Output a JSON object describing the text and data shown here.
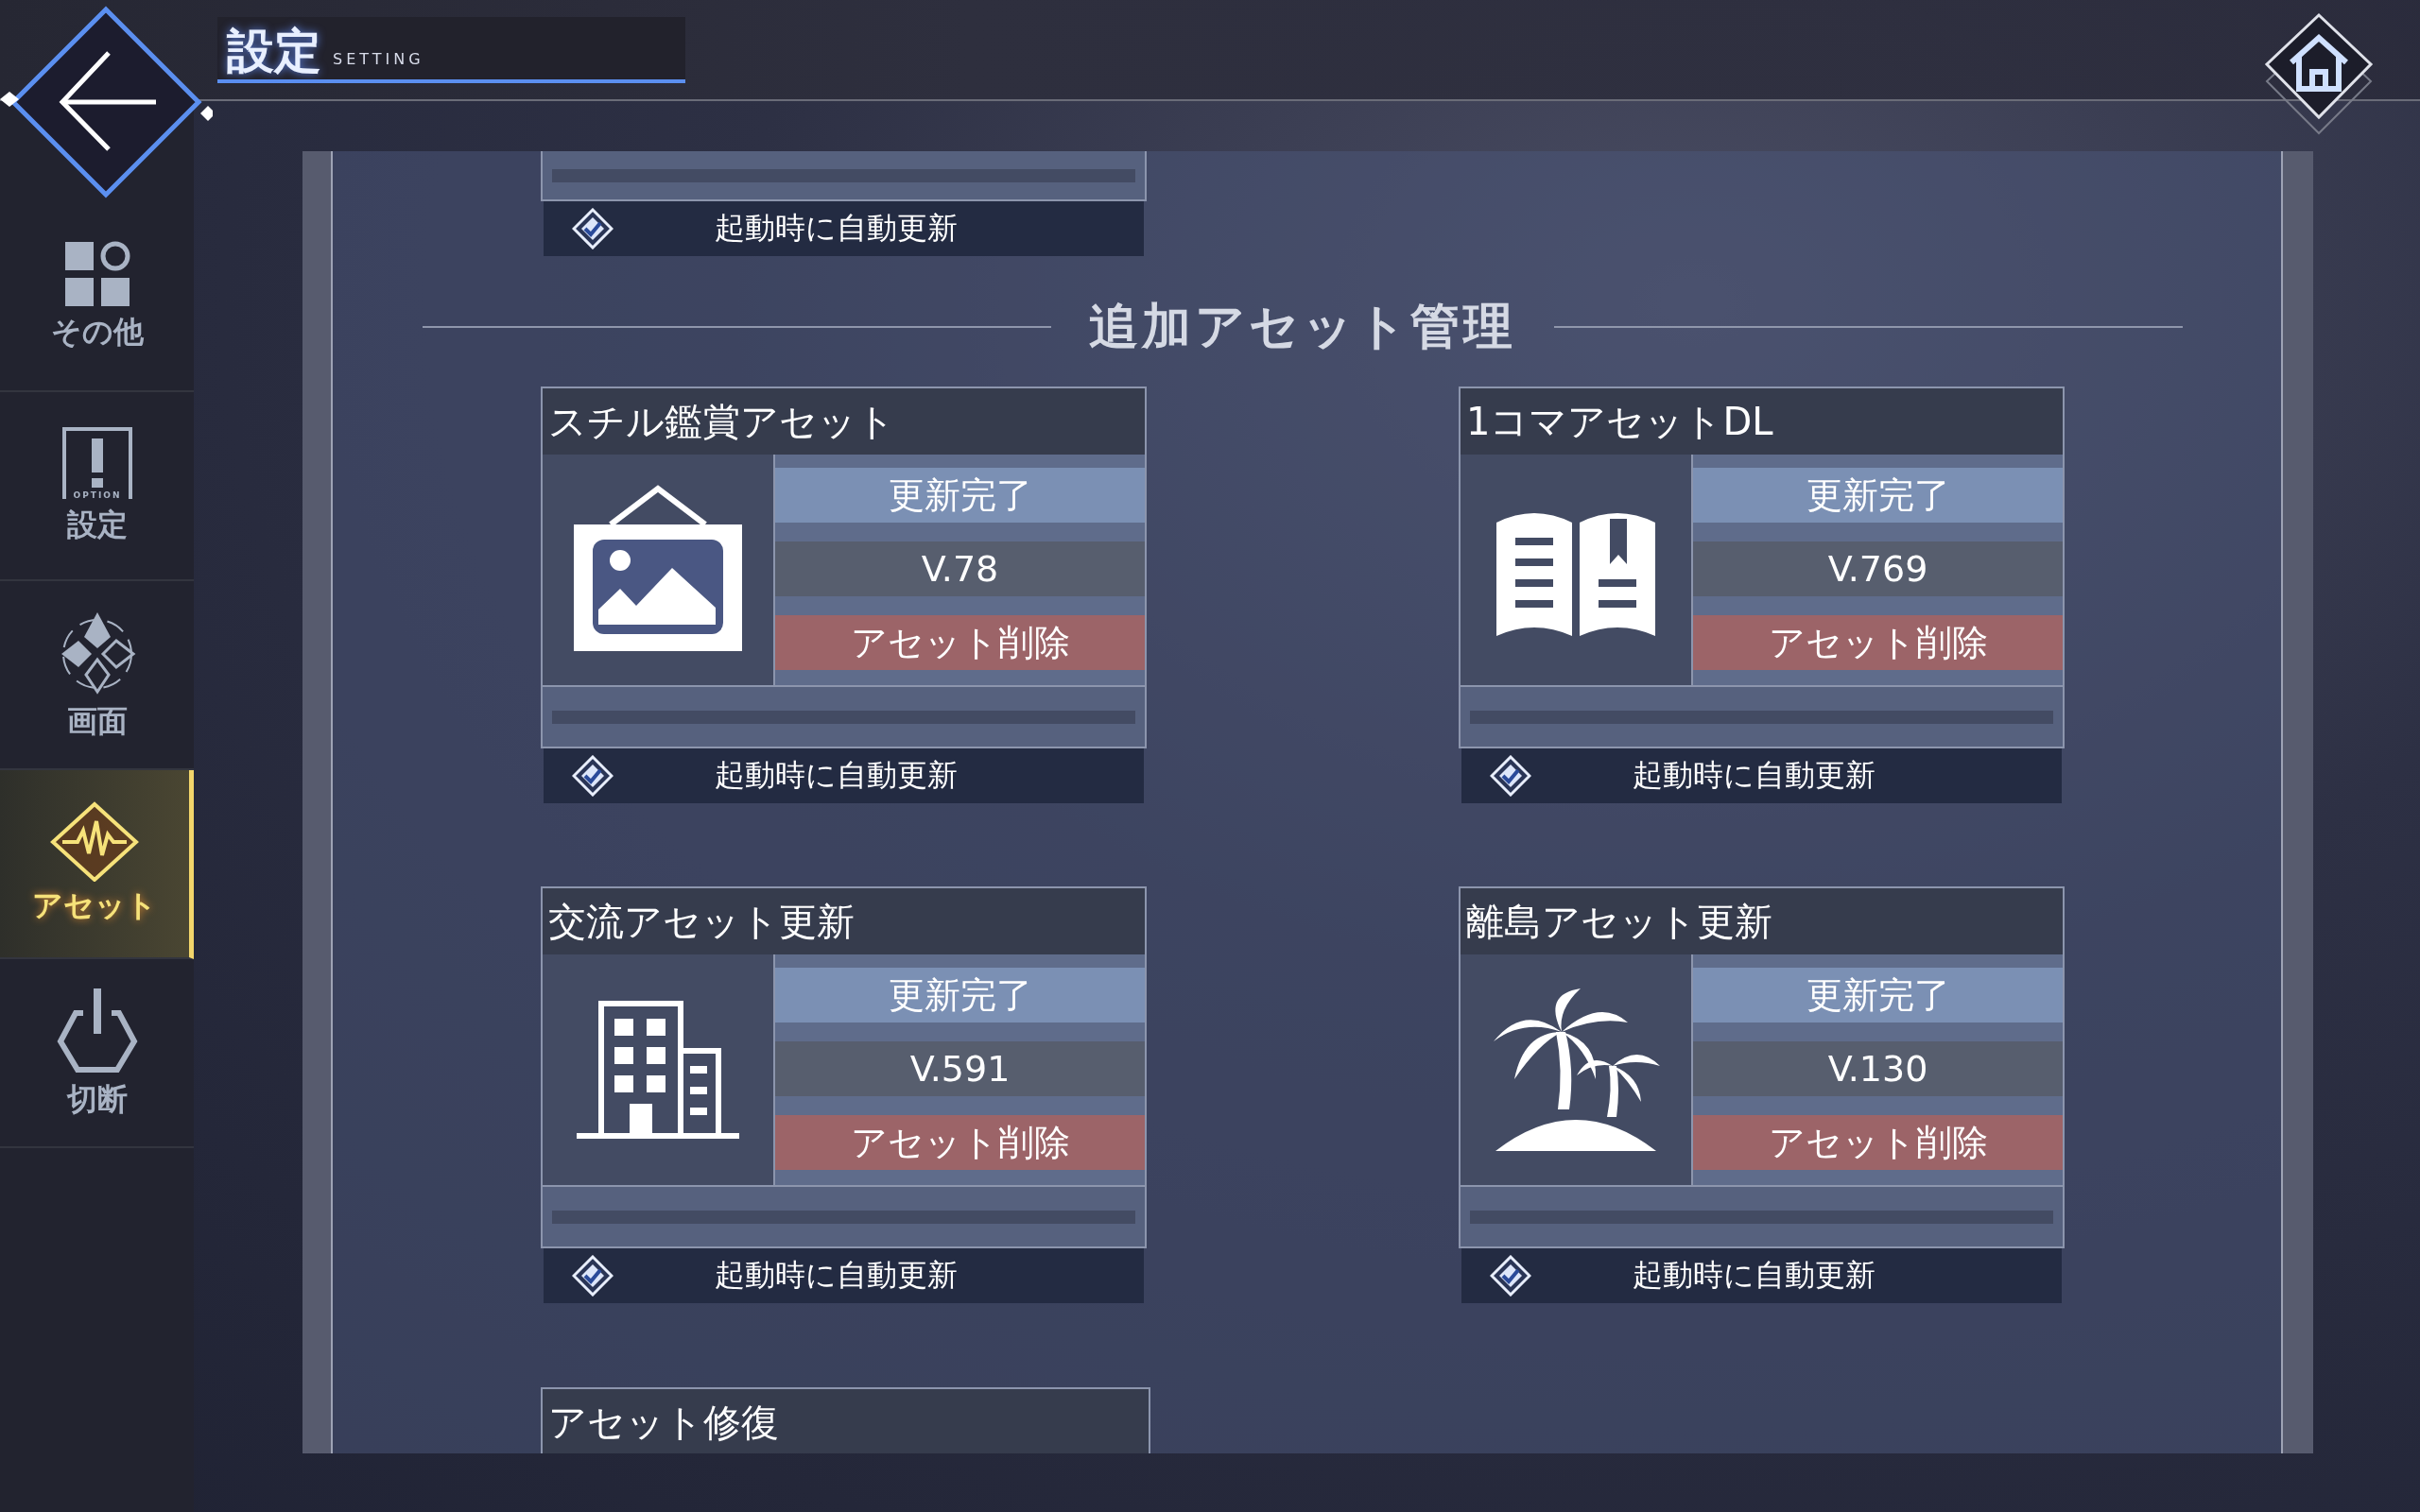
{
  "header": {
    "title": "設定",
    "subtitle": "SETTING"
  },
  "sidebar": {
    "items": [
      {
        "label": "その他",
        "selected": false
      },
      {
        "label": "設定",
        "selected": false,
        "icon_text": "OPTION"
      },
      {
        "label": "画面",
        "selected": false
      },
      {
        "label": "アセット",
        "selected": true
      },
      {
        "label": "切断",
        "selected": false
      }
    ]
  },
  "partial_card": {
    "auto_update": {
      "label": "起動時に自動更新",
      "checked": true
    }
  },
  "section_title": "追加アセット管理",
  "asset_cards": [
    {
      "title": "スチル鑑賞アセット",
      "status": "更新完了",
      "version": "V.78",
      "delete_button": "アセット削除",
      "auto_update": {
        "label": "起動時に自動更新",
        "checked": true
      }
    },
    {
      "title": "1コマアセットDL",
      "status": "更新完了",
      "version": "V.769",
      "delete_button": "アセット削除",
      "auto_update": {
        "label": "起動時に自動更新",
        "checked": true
      }
    },
    {
      "title": "交流アセット更新",
      "status": "更新完了",
      "version": "V.591",
      "delete_button": "アセット削除",
      "auto_update": {
        "label": "起動時に自動更新",
        "checked": true
      }
    },
    {
      "title": "離島アセット更新",
      "status": "更新完了",
      "version": "V.130",
      "delete_button": "アセット削除",
      "auto_update": {
        "label": "起動時に自動更新",
        "checked": true
      }
    }
  ],
  "repair_card": {
    "title": "アセット修復"
  }
}
